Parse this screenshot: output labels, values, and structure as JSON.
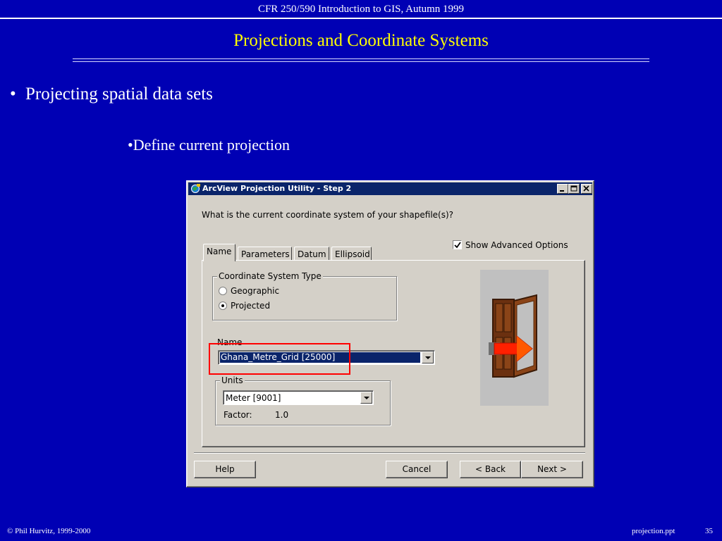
{
  "slide": {
    "header": "CFR 250/590 Introduction to GIS, Autumn 1999",
    "title": "Projections and Coordinate Systems",
    "bullet_1": "Projecting spatial data sets",
    "bullet_2": "•Define current projection",
    "footer_left": "© Phil Hurvitz, 1999-2000",
    "footer_file": "projection.ppt",
    "page_number": "35"
  },
  "dialog": {
    "title": "ArcView Projection Utility - Step 2",
    "question": "What is the current coordinate system of your shapefile(s)?",
    "show_advanced_label": "Show Advanced Options",
    "show_advanced_checked": true,
    "tabs": [
      "Name",
      "Parameters",
      "Datum",
      "Ellipsoid"
    ],
    "active_tab": "Name",
    "coordinate_system_type": {
      "legend": "Coordinate System Type",
      "options": [
        "Geographic",
        "Projected"
      ],
      "selected": "Projected"
    },
    "name_label": "Name",
    "name_value": "Ghana_Metre_Grid [25000]",
    "units": {
      "legend": "Units",
      "value": "Meter [9001]",
      "factor_label": "Factor:",
      "factor_value": "1.0"
    },
    "buttons": {
      "help": "Help",
      "cancel": "Cancel",
      "back": "< Back",
      "next": "Next >"
    },
    "highlight_color": "#ff0000"
  },
  "colors": {
    "slide_background": "#0000b4",
    "title_color": "#ffff00",
    "titlebar": "#0a246a",
    "dialog_face": "#d4d0c8"
  }
}
